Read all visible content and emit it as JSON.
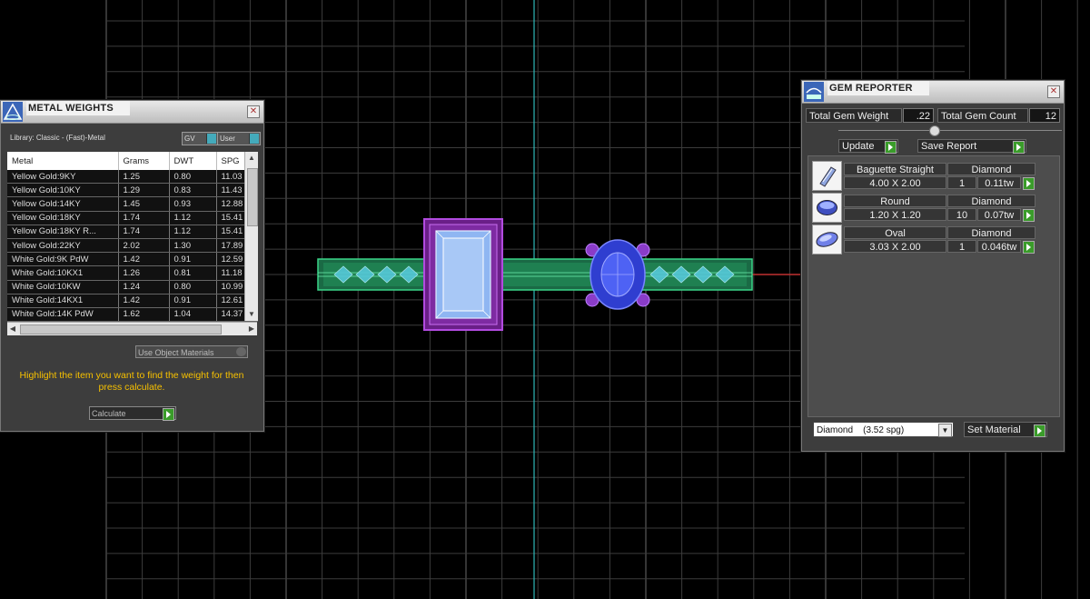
{
  "metal_weights": {
    "title": "METAL WEIGHTS",
    "library": "Library: Classic - (Fast)-Metal",
    "gv_label": "GV",
    "user_label": "User",
    "columns": [
      "Metal",
      "Grams",
      "DWT",
      "SPG"
    ],
    "rows": [
      [
        "Yellow Gold:9KY",
        "1.25",
        "0.80",
        "11.03"
      ],
      [
        "Yellow Gold:10KY",
        "1.29",
        "0.83",
        "11.43"
      ],
      [
        "Yellow Gold:14KY",
        "1.45",
        "0.93",
        "12.88"
      ],
      [
        "Yellow Gold:18KY",
        "1.74",
        "1.12",
        "15.41"
      ],
      [
        "Yellow Gold:18KY R...",
        "1.74",
        "1.12",
        "15.41"
      ],
      [
        "Yellow Gold:22KY",
        "2.02",
        "1.30",
        "17.89"
      ],
      [
        "White Gold:9K PdW",
        "1.42",
        "0.91",
        "12.59"
      ],
      [
        "White Gold:10KX1",
        "1.26",
        "0.81",
        "11.18"
      ],
      [
        "White Gold:10KW",
        "1.24",
        "0.80",
        "10.99"
      ],
      [
        "White Gold:14KX1",
        "1.42",
        "0.91",
        "12.61"
      ],
      [
        "White Gold:14K PdW",
        "1.62",
        "1.04",
        "14.37"
      ]
    ],
    "use_object_materials": "Use Object Materials",
    "hint": "Highlight the item you want to find the weight for then press calculate.",
    "calculate": "Calculate"
  },
  "gem_reporter": {
    "title": "GEM REPORTER",
    "total_weight_label": "Total Gem Weight",
    "total_weight_value": ".22",
    "total_count_label": "Total Gem Count",
    "total_count_value": "12",
    "update_label": "Update",
    "save_report_label": "Save Report",
    "gems": [
      {
        "name": "Baguette Straight",
        "material": "Diamond",
        "dims": "4.00 X 2.00",
        "count": "1",
        "weight": "0.11tw",
        "icon": "baguette-gem-icon"
      },
      {
        "name": "Round",
        "material": "Diamond",
        "dims": "1.20 X 1.20",
        "count": "10",
        "weight": "0.07tw",
        "icon": "round-gem-icon"
      },
      {
        "name": "Oval",
        "material": "Diamond",
        "dims": "3.03 X 2.00",
        "count": "1",
        "weight": "0.046tw",
        "icon": "oval-gem-icon"
      }
    ],
    "material_select": "Diamond    (3.52 spg)",
    "set_material_label": "Set Material"
  },
  "colors": {
    "panel_bg": "#3d3d3d",
    "grid": "#555555",
    "axis_cyan": "#2fb8b8",
    "axis_red": "#c03030",
    "band_green": "#2fae6d",
    "setting_purple": "#8a2eb0",
    "gem_blue": "#4860f0",
    "hint_yellow": "#f6c000"
  }
}
